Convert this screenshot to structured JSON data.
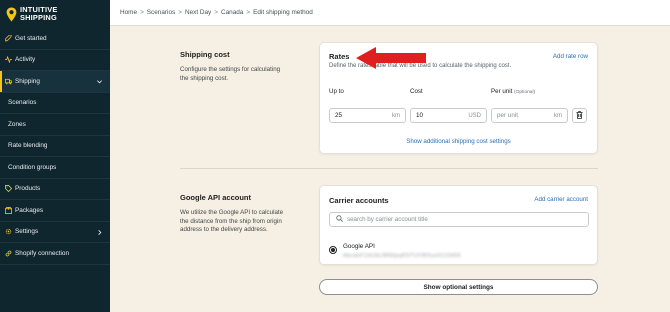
{
  "brand": {
    "line1": "INTUITIVE",
    "line2": "SHIPPING",
    "accent": "#f5c518"
  },
  "sidebar": {
    "items": [
      {
        "label": "Get started",
        "icon": "rocket-icon"
      },
      {
        "label": "Activity",
        "icon": "activity-icon"
      },
      {
        "label": "Shipping",
        "icon": "truck-icon"
      },
      {
        "label": "Scenarios"
      },
      {
        "label": "Zones"
      },
      {
        "label": "Rate blending"
      },
      {
        "label": "Condition groups"
      },
      {
        "label": "Products",
        "icon": "tag-icon"
      },
      {
        "label": "Packages",
        "icon": "package-icon"
      },
      {
        "label": "Settings",
        "icon": "gear-icon"
      },
      {
        "label": "Shopify connection",
        "icon": "link-icon"
      }
    ]
  },
  "breadcrumb": [
    "Home",
    "Scenarios",
    "Next Day",
    "Canada",
    "Edit shipping method"
  ],
  "breadcrumb_sep": ">",
  "shipping_cost": {
    "title": "Shipping cost",
    "description_lines": [
      "Configure the settings for calculating",
      "the shipping cost."
    ]
  },
  "rates_card": {
    "title": "Rates",
    "add_link": "Add rate row",
    "subtitle": "Define the rates table that will be used to calculate the shipping cost.",
    "col_upto": "Up to",
    "col_cost": "Cost",
    "col_perunit": "Per unit",
    "col_perunit_note": "(Optional)",
    "row": {
      "upto": "25",
      "upto_unit": "km",
      "cost": "10",
      "cost_unit": "USD",
      "perunit_placeholder": "per unit",
      "perunit_unit": "km"
    },
    "show_more": "Show additional shipping cost settings"
  },
  "google_api": {
    "title": "Google API account",
    "description_lines": [
      "We utilize the Google API to calculate",
      "the distance from the ship from origin",
      "address to the delivery address."
    ]
  },
  "carrier_card": {
    "title": "Carrier accounts",
    "add_link": "Add carrier account",
    "search_placeholder": "search by carrier account title",
    "account_name": "Google API",
    "account_id": "AbcdeF1HiJkLMN0pqRSTUVWXyz0123456"
  },
  "optional_button": "Show optional settings"
}
